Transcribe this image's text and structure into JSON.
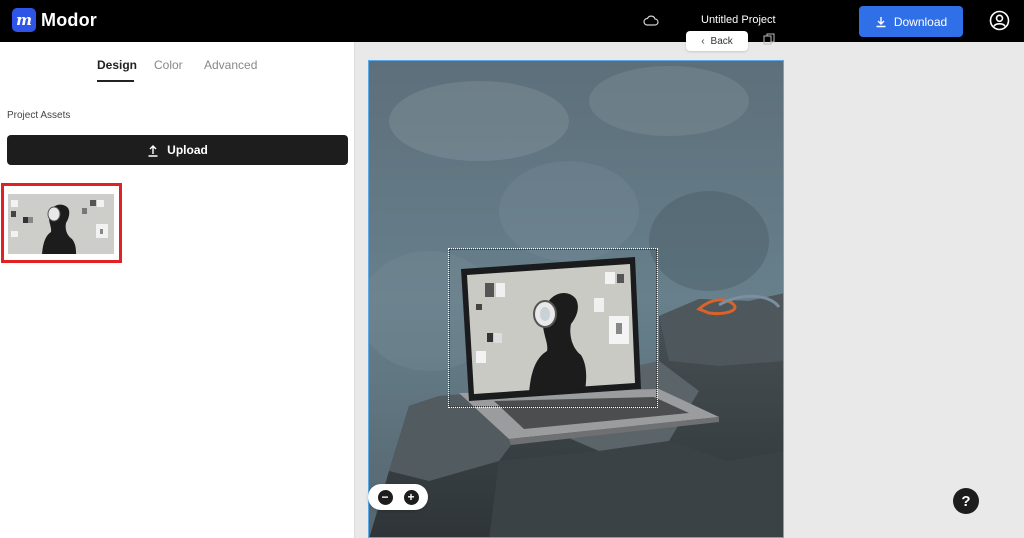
{
  "app": {
    "logo_mark": "m",
    "logo_text": "Modor",
    "project_title": "Untitled Project",
    "download_label": "Download"
  },
  "left_panel": {
    "tabs": [
      {
        "label": "Design"
      },
      {
        "label": "Color"
      },
      {
        "label": "Advanced"
      }
    ],
    "active_tab": "Design",
    "assets_label": "Project Assets",
    "upload_label": "Upload"
  },
  "canvas": {
    "back_label": "Back",
    "zoom_out_symbol": "−",
    "zoom_in_symbol": "+"
  },
  "help_symbol": "?",
  "colors": {
    "topbar": "#000000",
    "accent_blue": "#2f6fe8",
    "logo_blue": "#2f55e8",
    "dark_button": "#1d1d1d",
    "selection_highlight": "#e02222",
    "canvas_border": "#5aa8e6"
  },
  "icons": [
    "cloud-icon",
    "download-icon",
    "account-icon",
    "upload-icon",
    "back-arrow-icon",
    "duplicate-icon",
    "zoom-out-icon",
    "zoom-in-icon",
    "help-icon"
  ]
}
